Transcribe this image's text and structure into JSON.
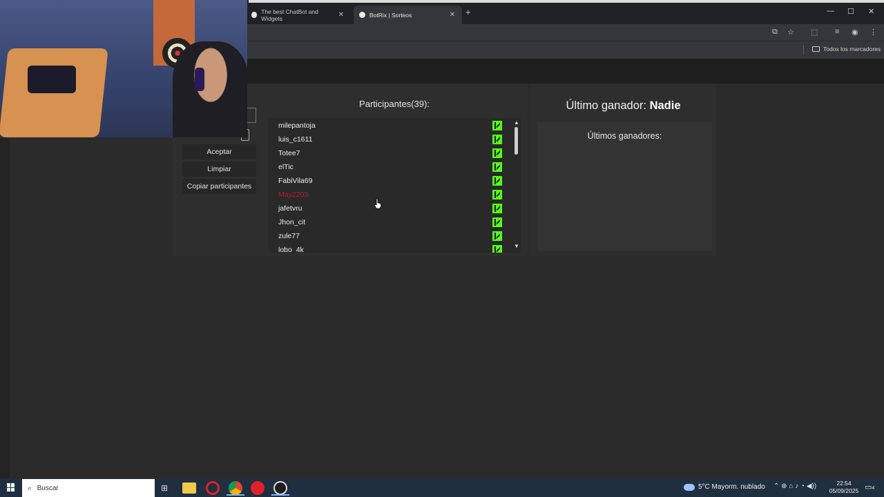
{
  "browser": {
    "tabs": [
      {
        "label": "The best ChatBot and Widgets",
        "active": false
      },
      {
        "label": "BotRix | Sorteos",
        "active": true
      }
    ],
    "new_tab": "+",
    "close_glyph": "✕",
    "window_controls": {
      "minimize": "—",
      "maximize": "☐",
      "close": "✕"
    },
    "toolbar_icons": [
      "translate-icon",
      "star-icon",
      "extensions-icon",
      "media-icon",
      "profile-icon",
      "menu-icon"
    ],
    "bookmarks": {
      "all_bookmarks": "Todos los marcadores"
    }
  },
  "raffle": {
    "buttons": {
      "accept": "Aceptar",
      "clear": "Limpiar",
      "copy": "Copiar participantes"
    },
    "participants_title": "Participantes(39):",
    "participants": [
      {
        "name": "milepantoja",
        "color": "#f0f0f0"
      },
      {
        "name": "luis_c1611",
        "color": "#f0f0f0"
      },
      {
        "name": "Totee7",
        "color": "#f0f0f0"
      },
      {
        "name": "elTic",
        "color": "#f0f0f0"
      },
      {
        "name": "FabiVila69",
        "color": "#f0f0f0"
      },
      {
        "name": "May2203",
        "color": "#c01a2a"
      },
      {
        "name": "jafetvru",
        "color": "#f0f0f0"
      },
      {
        "name": "Jhon_cit",
        "color": "#f0f0f0"
      },
      {
        "name": "zule77",
        "color": "#f0f0f0"
      },
      {
        "name": "lobo_4k",
        "color": "#f0f0f0"
      }
    ],
    "platform_icon": "kick-icon",
    "last_winner_prefix": "Último ganador:",
    "last_winner_name": "Nadie",
    "last_winners_label": "Últimos ganadores:"
  },
  "taskbar": {
    "search_placeholder": "Buscar",
    "weather": "5°C  Mayorm. nublado",
    "time": "22:54",
    "date": "05/09/2025",
    "notification_count": "4"
  },
  "colors": {
    "kick_green": "#53fc18",
    "highlight_red": "#c01a2a",
    "panel": "#2e2e2e"
  }
}
